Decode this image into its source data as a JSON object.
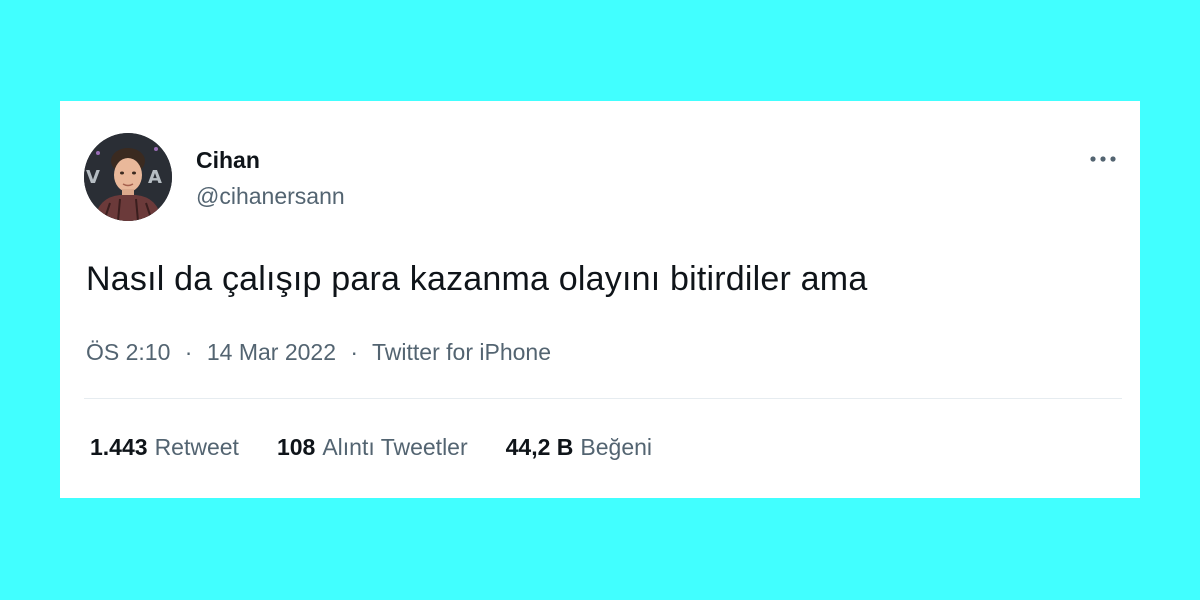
{
  "tweet": {
    "author": {
      "name": "Cihan",
      "handle": "@cihanersann"
    },
    "text": "Nasıl da çalışıp para kazanma olayını bitirdiler ama",
    "time": "ÖS 2:10",
    "date": "14 Mar 2022",
    "source": "Twitter for iPhone",
    "separator": "·",
    "stats": [
      {
        "value": "1.443",
        "label": "Retweet"
      },
      {
        "value": "108",
        "label": "Alıntı Tweetler"
      },
      {
        "value": "44,2 B",
        "label": "Beğeni"
      }
    ]
  },
  "icons": {
    "more": "more-horizontal-icon"
  },
  "colors": {
    "background": "#41ffff",
    "card": "#ffffff",
    "primary_text": "#0f1419",
    "secondary_text": "#536471",
    "divider": "#e6ecf0"
  }
}
